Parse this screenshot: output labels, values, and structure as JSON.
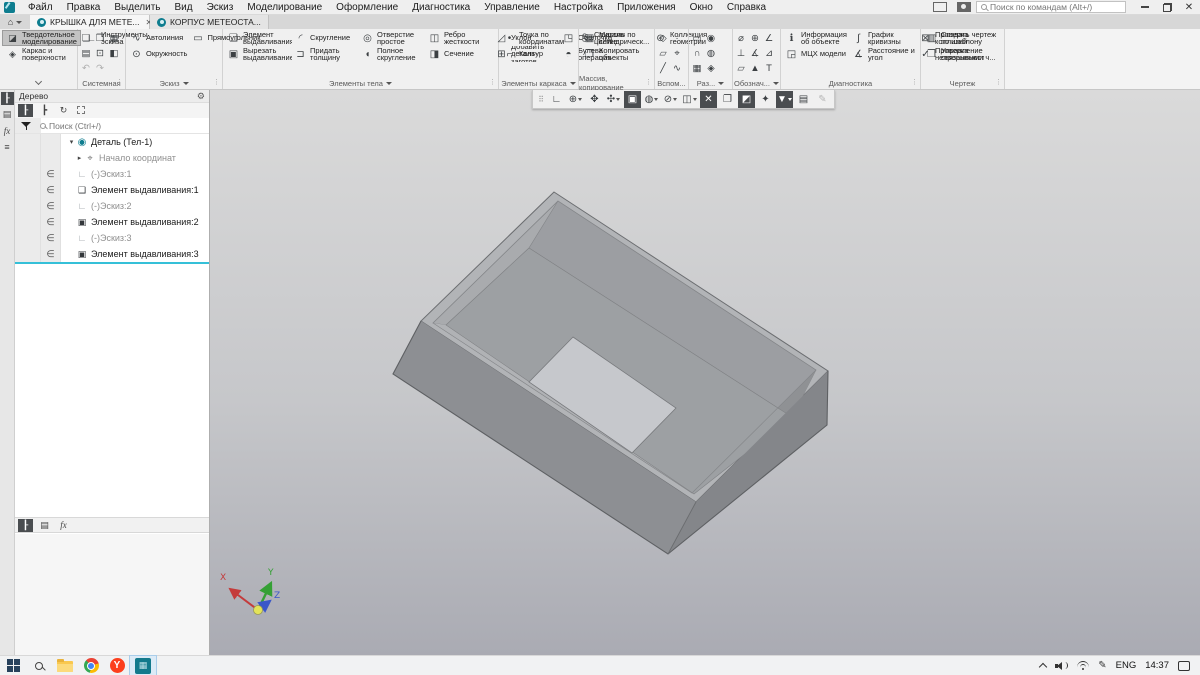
{
  "window": {
    "search_placeholder": "Поиск по командам (Alt+/)"
  },
  "menu": {
    "items": [
      {
        "label": "Файл"
      },
      {
        "label": "Правка"
      },
      {
        "label": "Выделить"
      },
      {
        "label": "Вид"
      },
      {
        "label": "Эскиз"
      },
      {
        "label": "Моделирование"
      },
      {
        "label": "Оформление"
      },
      {
        "label": "Диагностика"
      },
      {
        "label": "Управление"
      },
      {
        "label": "Настройка"
      },
      {
        "label": "Приложения"
      },
      {
        "label": "Окно"
      },
      {
        "label": "Справка"
      }
    ]
  },
  "tabs": {
    "home_glyph": "⌂",
    "items": [
      {
        "label": "КРЫШКА ДЛЯ МЕТЕ...",
        "active": true,
        "inactive": false,
        "closable": true,
        "close_glyph": "✕"
      },
      {
        "label": "КОРПУС МЕТЕОСТА...",
        "active": false,
        "inactive": true,
        "closable": false,
        "close_glyph": ""
      }
    ]
  },
  "ribbon": {
    "modes": {
      "label_hidden": "",
      "items": [
        {
          "label": "Твердотельное моделирование",
          "glyph": "◪",
          "active": true
        },
        {
          "label": "Каркас и поверхности",
          "glyph": "◈",
          "active": false
        },
        {
          "label": "Инструменты эскиза",
          "glyph": "∟",
          "active": false
        }
      ]
    },
    "system": {
      "label": "Системная",
      "icons": [
        {
          "name": "new-document-icon",
          "glyph": "❏",
          "gray": false
        },
        {
          "name": "open-document-icon",
          "glyph": "❒",
          "gray": false
        },
        {
          "name": "save-icon",
          "glyph": "▦",
          "gray": false
        },
        {
          "name": "print-icon",
          "glyph": "▤",
          "gray": false
        },
        {
          "name": "preview-icon",
          "glyph": "⊡",
          "gray": false
        },
        {
          "name": "insert-icon",
          "glyph": "◧",
          "gray": false
        },
        {
          "name": "undo-icon",
          "glyph": "↶",
          "gray": true
        },
        {
          "name": "redo-icon",
          "glyph": "↷",
          "gray": true
        }
      ]
    },
    "sketch": {
      "label": "Эскиз",
      "items": [
        {
          "label": "Автолиния",
          "glyph": "∿"
        },
        {
          "label": "Окружность",
          "glyph": "⊙"
        },
        {
          "label": "Прямоугольник",
          "glyph": "▭"
        }
      ]
    },
    "body": {
      "label": "Элементы тела",
      "items": [
        {
          "label": "Элемент выдавливания",
          "glyph": "❑"
        },
        {
          "label": "Вырезать выдавливанием",
          "glyph": "▣"
        },
        {
          "label": "Скругление",
          "glyph": "◜"
        },
        {
          "label": "Придать толщину",
          "glyph": "⊐"
        },
        {
          "label": "Отверстие простое",
          "glyph": "◎"
        },
        {
          "label": "Полное скругление",
          "glyph": "◖"
        },
        {
          "label": "Ребро жесткости",
          "glyph": "◫"
        },
        {
          "label": "Сечение",
          "glyph": "◨"
        },
        {
          "label": "Уклон",
          "glyph": "◿"
        },
        {
          "label": "Добавить деталь-заготов...",
          "glyph": "⊞"
        },
        {
          "label": "Оболочка",
          "glyph": "◳"
        },
        {
          "label": "Булева операция",
          "glyph": "◓"
        }
      ]
    },
    "frame": {
      "label": "Элементы каркаса",
      "items": [
        {
          "label": "Точка по координатам",
          "glyph": "•"
        },
        {
          "label": "Контур",
          "glyph": "⌐"
        },
        {
          "label": "Спираль цилиндрическ...",
          "glyph": "§"
        }
      ]
    },
    "array": {
      "label": "Массив, копирование",
      "items": [
        {
          "label": "Массив по сетке",
          "glyph": "▦"
        },
        {
          "label": "Копировать объекты",
          "glyph": "❐"
        },
        {
          "label": "Коллекция геометрии",
          "glyph": "⊛"
        }
      ]
    },
    "aux": {
      "label": "Вспом...",
      "icons": [
        {
          "name": "construction-plane-icon",
          "glyph": "◇",
          "gray": false
        },
        {
          "name": "construction-point-icon",
          "glyph": "∙",
          "gray": false
        },
        {
          "name": "plane-through-icon",
          "glyph": "▱",
          "gray": false
        },
        {
          "name": "local-csys-icon",
          "glyph": "⌖",
          "gray": false
        },
        {
          "name": "construction-axis-icon",
          "glyph": "╱",
          "gray": false
        },
        {
          "name": "spline-icon",
          "glyph": "∿",
          "gray": false
        }
      ]
    },
    "razn": {
      "label": "Раз...",
      "icons": [
        {
          "name": "split-face-icon",
          "glyph": "▭",
          "gray": false
        },
        {
          "name": "round-hole-icon",
          "glyph": "◉",
          "gray": false
        },
        {
          "name": "arc-split-icon",
          "glyph": "∩",
          "gray": false
        },
        {
          "name": "region-icon",
          "glyph": "◍",
          "gray": false
        },
        {
          "name": "mesh-icon",
          "glyph": "▦",
          "gray": false
        },
        {
          "name": "facet-icon",
          "glyph": "◈",
          "gray": false
        }
      ]
    },
    "notation": {
      "label": "Обознач...",
      "icons": [
        {
          "name": "diameter-dim-icon",
          "glyph": "⌀",
          "gray": false
        },
        {
          "name": "hole-axis-icon",
          "glyph": "⊕",
          "gray": false
        },
        {
          "name": "angle-dim-icon",
          "glyph": "∠",
          "gray": false
        },
        {
          "name": "perpendicular-icon",
          "glyph": "⊥",
          "gray": false
        },
        {
          "name": "angularity-icon",
          "glyph": "∡",
          "gray": false
        },
        {
          "name": "slope-icon",
          "glyph": "⊿",
          "gray": false
        },
        {
          "name": "datum-icon",
          "glyph": "▱",
          "gray": false
        },
        {
          "name": "roughness-icon",
          "glyph": "▲",
          "gray": false
        },
        {
          "name": "text-label-icon",
          "glyph": "T",
          "gray": false
        }
      ]
    },
    "diagnostics": {
      "label": "Диагностика",
      "items": [
        {
          "label": "Информация об объекте",
          "glyph": "ℹ"
        },
        {
          "label": "МЦХ модели",
          "glyph": "◲"
        },
        {
          "label": "График кривизны",
          "glyph": "∫"
        },
        {
          "label": "Расстояние и угол",
          "glyph": "∡"
        },
        {
          "label": "Проверка коллизий",
          "glyph": "⊠"
        },
        {
          "label": "Проверка непрерывности",
          "glyph": "✓"
        }
      ]
    },
    "drawing": {
      "label": "Чертеж",
      "items": [
        {
          "label": "Создать чертеж по шаблону",
          "glyph": "▥"
        },
        {
          "label": "Управление связанными ч...",
          "glyph": "❒"
        }
      ]
    }
  },
  "tree": {
    "title": "Дерево",
    "gear_glyph": "⚙",
    "search_placeholder": "Поиск (Ctrl+/)",
    "toolbar": [
      {
        "name": "tree-structure-view-icon",
        "glyph": "┠",
        "active": true
      },
      {
        "name": "tree-sequence-view-icon",
        "glyph": "┣",
        "active": false
      },
      {
        "name": "tree-relations-icon",
        "glyph": "↻",
        "active": false
      }
    ],
    "rows": [
      {
        "label": "Деталь (Тел-1)",
        "glyph": "◉",
        "icon_class": "part",
        "expander": "▾",
        "eye_visible": false,
        "eye_hidden": false,
        "elem": false,
        "dim": false,
        "deep": false,
        "selected": false
      },
      {
        "label": "Начало координат",
        "glyph": "⌖",
        "icon_class": "origin",
        "expander": "▸",
        "eye_visible": false,
        "eye_hidden": true,
        "elem": false,
        "dim": true,
        "deep": true,
        "selected": false
      },
      {
        "label": "(-)Эскиз:1",
        "glyph": "∟",
        "icon_class": "sketch",
        "expander": "",
        "eye_visible": false,
        "eye_hidden": true,
        "elem": true,
        "dim": true,
        "deep": false,
        "selected": false
      },
      {
        "label": "Элемент выдавливания:1",
        "glyph": "❑",
        "icon_class": "solid",
        "expander": "",
        "eye_visible": true,
        "eye_hidden": false,
        "elem": true,
        "dim": false,
        "deep": false,
        "selected": false
      },
      {
        "label": "(-)Эскиз:2",
        "glyph": "∟",
        "icon_class": "sketch",
        "expander": "",
        "eye_visible": false,
        "eye_hidden": true,
        "elem": true,
        "dim": true,
        "deep": false,
        "selected": false
      },
      {
        "label": "Элемент выдавливания:2",
        "glyph": "▣",
        "icon_class": "solid",
        "expander": "",
        "eye_visible": false,
        "eye_hidden": false,
        "elem": true,
        "dim": false,
        "deep": false,
        "selected": false
      },
      {
        "label": "(-)Эскиз:3",
        "glyph": "∟",
        "icon_class": "sketch",
        "expander": "",
        "eye_visible": false,
        "eye_hidden": true,
        "elem": true,
        "dim": true,
        "deep": false,
        "selected": false
      },
      {
        "label": "Элемент выдавливания:3",
        "glyph": "▣",
        "icon_class": "solid",
        "expander": "",
        "eye_visible": false,
        "eye_hidden": false,
        "elem": true,
        "dim": false,
        "deep": false,
        "selected": true
      }
    ]
  },
  "viewport": {
    "toolbar": [
      {
        "name": "toolbar-drag-handle",
        "glyph": "⠿",
        "pressed": false,
        "dropdown": false,
        "disabled": false,
        "handle": true
      },
      {
        "name": "placement-icon",
        "glyph": "∟",
        "pressed": false,
        "dropdown": false,
        "disabled": false,
        "handle": false
      },
      {
        "name": "zoom-icon",
        "glyph": "⊕",
        "pressed": false,
        "dropdown": true,
        "disabled": false,
        "handle": false
      },
      {
        "name": "orientation-icon",
        "glyph": "✥",
        "pressed": false,
        "dropdown": false,
        "disabled": false,
        "handle": false
      },
      {
        "name": "view-axes-icon",
        "glyph": "✣",
        "pressed": false,
        "dropdown": true,
        "disabled": false,
        "handle": false
      },
      {
        "name": "solid-display-icon",
        "glyph": "▣",
        "pressed": true,
        "dropdown": false,
        "disabled": false,
        "handle": false
      },
      {
        "name": "render-mode-icon",
        "glyph": "◍",
        "pressed": false,
        "dropdown": true,
        "disabled": false,
        "handle": false
      },
      {
        "name": "hide-objects-icon",
        "glyph": "⊘",
        "pressed": false,
        "dropdown": true,
        "disabled": false,
        "handle": false
      },
      {
        "name": "clip-view-icon",
        "glyph": "◫",
        "pressed": false,
        "dropdown": true,
        "disabled": false,
        "handle": false
      },
      {
        "name": "simplify-display-icon",
        "glyph": "✕",
        "pressed": true,
        "dropdown": false,
        "disabled": false,
        "handle": false
      },
      {
        "name": "copy-appearance-icon",
        "glyph": "❐",
        "pressed": false,
        "dropdown": false,
        "disabled": false,
        "handle": false
      },
      {
        "name": "hidden-lines-icon",
        "glyph": "◩",
        "pressed": true,
        "dropdown": false,
        "disabled": false,
        "handle": false
      },
      {
        "name": "scene-lighting-icon",
        "glyph": "✦",
        "pressed": false,
        "dropdown": false,
        "disabled": false,
        "handle": false
      },
      {
        "name": "filter-icon",
        "glyph": "▼",
        "pressed": true,
        "dropdown": true,
        "disabled": false,
        "handle": false
      },
      {
        "name": "workplane-tool-icon",
        "glyph": "▤",
        "pressed": false,
        "dropdown": false,
        "disabled": false,
        "handle": false
      },
      {
        "name": "edit-pen-icon",
        "glyph": "✎",
        "pressed": false,
        "dropdown": false,
        "disabled": true,
        "handle": false
      }
    ],
    "triad": {
      "x_label": "X",
      "y_label": "Y",
      "z_label": "Z",
      "x_color": "#c43b3b",
      "y_color": "#35a035",
      "z_color": "#3a57c9",
      "origin_color": "#e3e35a"
    },
    "model_colors": {
      "rim_top": "#b2b4b7",
      "interior_wall_nw": "#a9abae",
      "interior_wall_ne": "#9c9ea2",
      "floor": "#9da0a3",
      "hole_opening": "#c6c8cc",
      "outer_wall_left": "#8d8f93",
      "outer_wall_right": "#84868a",
      "edge": "#5e6063"
    }
  },
  "taskbar": {
    "yandex_letter": "Y",
    "kompas_glyph": "▦",
    "language": "ENG",
    "time": "14:37"
  }
}
